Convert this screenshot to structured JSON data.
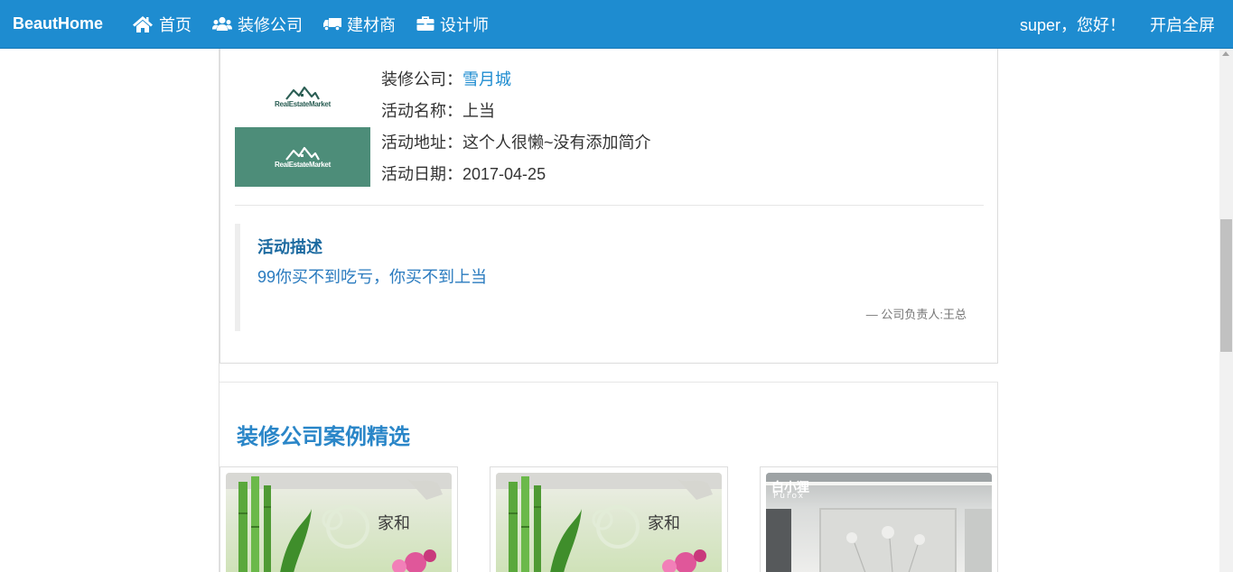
{
  "navbar": {
    "brand": "BeautHome",
    "items": [
      {
        "label": "首页",
        "icon": "home-icon"
      },
      {
        "label": "装修公司",
        "icon": "users-icon"
      },
      {
        "label": "建材商",
        "icon": "truck-icon"
      },
      {
        "label": "设计师",
        "icon": "briefcase-icon"
      }
    ],
    "greeting": "super，您好！",
    "fullscreen": "开启全屏"
  },
  "activity": {
    "company_label": "装修公司：",
    "company_value": "雪月城",
    "name_label": "活动名称：",
    "name_value": "上当",
    "address_label": "活动地址：",
    "address_value": "这个人很懒~没有添加简介",
    "date_label": "活动日期：",
    "date_value": "2017-04-25",
    "logo_text": "RealEstateMarket"
  },
  "description": {
    "title": "活动描述",
    "text": "99你买不到吃亏，你买不到上当",
    "author": "— 公司负责人:王总"
  },
  "cases": {
    "title": "装修公司案例精选",
    "items": [
      {
        "type": "bamboo",
        "brand": ""
      },
      {
        "type": "bamboo",
        "brand": ""
      },
      {
        "type": "room",
        "brand": "白小狸"
      }
    ]
  },
  "colors": {
    "nav_bg": "#1e8cd0",
    "link": "#1e8cd0",
    "quote_title": "#1c6aa0",
    "quote_text": "#2a7bbf",
    "logo_green": "#4d8d79"
  }
}
